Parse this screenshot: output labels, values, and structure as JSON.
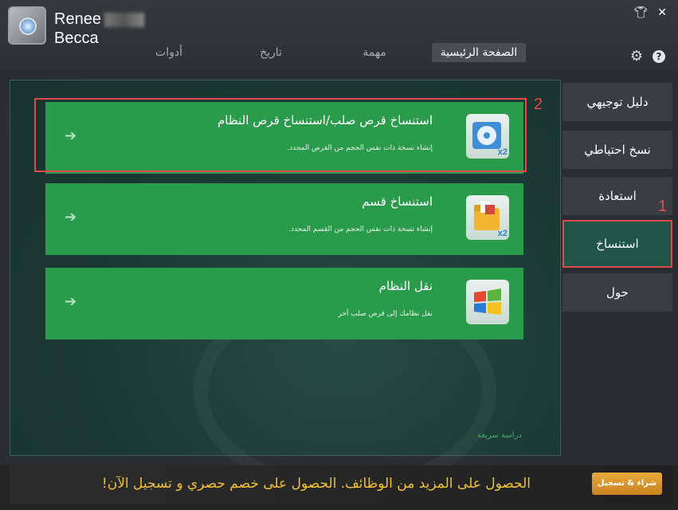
{
  "window": {
    "app_title_line1": "Renee",
    "app_title_line2": "Becca",
    "controls": [
      "shirt-icon",
      "close-icon"
    ]
  },
  "header": {
    "tabs": [
      {
        "label": "الصفحة الرئيسية",
        "active": true
      },
      {
        "label": "مهمة",
        "active": false
      },
      {
        "label": "تاريخ",
        "active": false
      },
      {
        "label": "أدوات",
        "active": false
      }
    ],
    "icons": [
      "gear-icon",
      "help-icon"
    ],
    "help_glyph": "?"
  },
  "sidebar": {
    "items": [
      {
        "label": "دليل توجيهي",
        "active": false
      },
      {
        "label": "نسخ احتياطي",
        "active": false
      },
      {
        "label": "استعادة",
        "active": false
      },
      {
        "label": "استنساخ",
        "active": true
      },
      {
        "label": "حول",
        "active": false
      }
    ],
    "annotation_number": "1"
  },
  "main": {
    "cards": [
      {
        "title": "استنساخ قرص صلب/استنساخ قرص النظام",
        "description": "إنشاء نسخة ذات نفس الحجم من القرص المحدد.",
        "icon": "disk-clone-icon",
        "badge": "x2"
      },
      {
        "title": "استنساخ قسم",
        "description": "إنشاء نسخة ذات نفس الحجم من القسم المحدد.",
        "icon": "folder-clone-icon",
        "badge": "x2"
      },
      {
        "title": "نقل النظام",
        "description": "نقل نظامك إلى قرص صلب آخر",
        "icon": "windows-logo-icon",
        "badge": ""
      }
    ],
    "annotation_number": "2",
    "quick_link": "دراسة سريعة"
  },
  "footer": {
    "promo": "الحصول على المزيد من الوظائف. الحصول على خصم حصري و تسجيل الآن!",
    "buy_button": "شراء & تسجيل"
  },
  "colors": {
    "card_green": "#2a9a4b",
    "highlight_red": "#e24a4a",
    "promo_yellow": "#f1c233",
    "button_orange": "#e8a93b"
  }
}
